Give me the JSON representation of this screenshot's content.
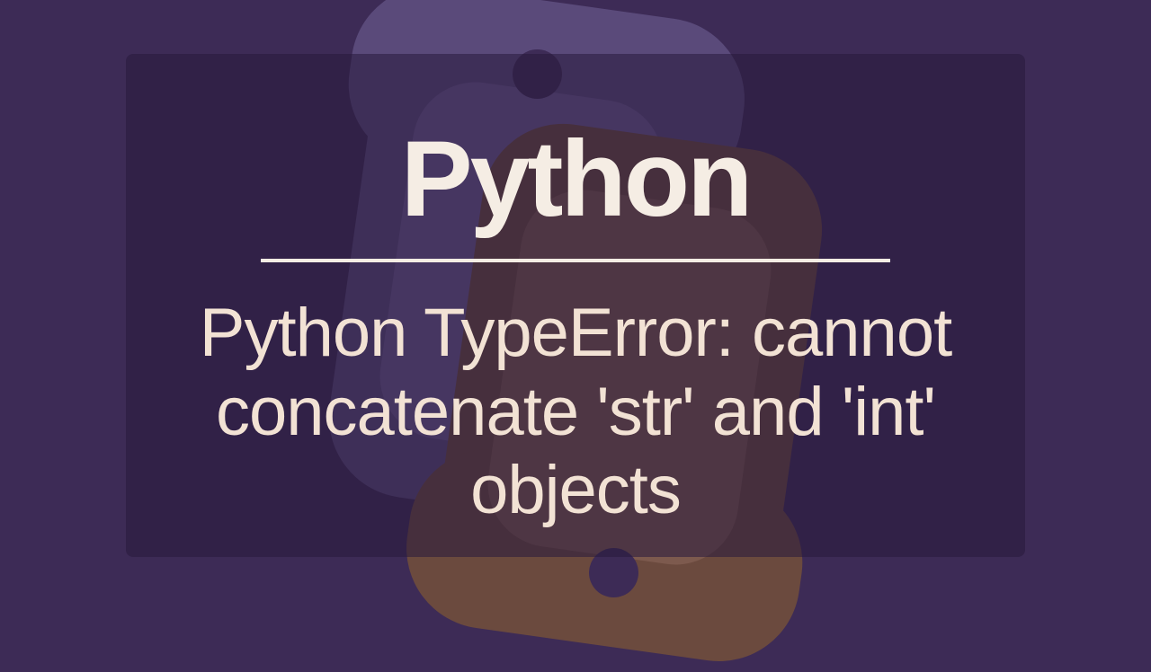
{
  "title": "Python",
  "subtitle": "Python TypeError: cannot concatenate 'str' and 'int' objects",
  "colors": {
    "background": "#3d2b56",
    "text_primary": "#f5ede4",
    "text_secondary": "#f2e2d4",
    "logo_blue": "#5a4a7a",
    "logo_blue_inner": "#6b5a8f",
    "logo_yellow": "#6b4a3e",
    "logo_yellow_inner": "#7d5a4e"
  }
}
